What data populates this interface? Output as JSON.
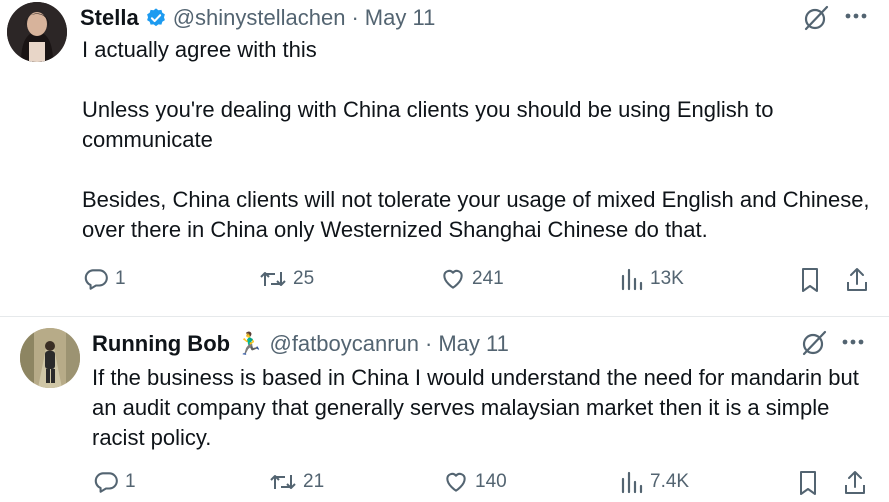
{
  "tweets": [
    {
      "name": "Stella",
      "handle": "@shinystellachen",
      "separator": "·",
      "date": "May 11",
      "paragraphs": [
        "I actually agree with this",
        "Unless you're dealing with China clients you should be using English to communicate",
        "Besides, China clients will not tolerate your usage of mixed English and Chinese, over there in China only Westernized Shanghai Chinese do that."
      ],
      "replies": "1",
      "reposts": "25",
      "likes": "241",
      "views": "13K"
    },
    {
      "name": "Running Bob",
      "name_emoji": "🏃‍♂️",
      "handle": "@fatboycanrun",
      "separator": "·",
      "date": "May 11",
      "paragraphs": [
        "If the business is based in China I would understand the need for mandarin but an audit company that generally serves malaysian market then it is a simple racist policy."
      ],
      "replies": "1",
      "reposts": "21",
      "likes": "140",
      "views": "7.4K"
    }
  ],
  "colors": {
    "verified": "#1d9bf0",
    "muted": "#536471",
    "text": "#0f1419"
  },
  "icons": [
    "verified-badge-icon",
    "grok-icon",
    "more-icon",
    "reply-icon",
    "repost-icon",
    "like-icon",
    "views-icon",
    "bookmark-icon",
    "share-icon"
  ]
}
